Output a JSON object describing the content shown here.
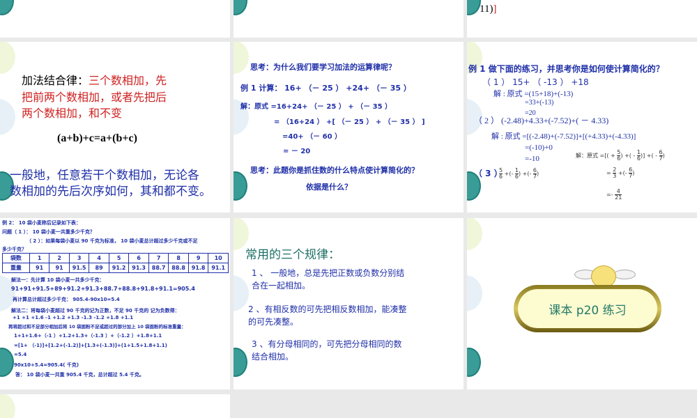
{
  "slides": [
    {
      "id": "s1"
    },
    {
      "id": "s2"
    },
    {
      "id": "s3",
      "fragment": "11)",
      "fragment_red": "]"
    },
    {
      "id": "s4",
      "title": "加法结合律：",
      "title_red": "三个数相加，先",
      "lines_red": [
        "把前两个数相加，或者先把后",
        "两个数相加，和不变"
      ],
      "formula": "(a+b)+c=a+(b+c)",
      "general": [
        "一般地，任意若干个数相加，无论各",
        "数相加的先后次序如何，其和都不变。"
      ]
    },
    {
      "id": "s5",
      "think1": "思考：为什么我们要学习加法的运算律呢？",
      "example": "例 1  计算： 16+ （－ 25 ） +24+ （－ 35 ）",
      "steps": [
        "解：原式 =16+24+ （－ 25 ） + （－ 35 ）",
        "= （16+24 ） +[ （－ 25 ） + （－ 35 ） ]",
        "=40+ （－ 60 ）",
        "= － 20"
      ],
      "think2": "思考：此题你是抓住数的什么特点使计算简化的？",
      "think3": "依据是什么？"
    },
    {
      "id": "s6",
      "title": "例 1 做下面的练习，并思考你是如何使计算简化的？",
      "p1": "（ 1 ）  15+ （ -13 ） +18",
      "p1_steps": [
        "解 : 原式 =(15+18)+(-13)",
        "=33+(-13)",
        "=20"
      ],
      "p2": "（ 2 ）  (-2.48)+4.33+(-7.52)+( － 4.33)",
      "p2_steps": [
        "解 : 原式 =[(-2.48)+(-7.52)]+[(+4.33)+(-4.33)]",
        "=(-10)+0",
        "=-10"
      ],
      "p3": "（ 3 ）",
      "p3_expr": {
        "a": [
          "5",
          "6"
        ],
        "b": [
          "1",
          "6"
        ],
        "c": [
          "6",
          "7"
        ]
      },
      "p3_sol_label": "解：原式 =[",
      "p3_sol2": [
        "2",
        "3"
      ],
      "p3_result": [
        "4",
        "21"
      ]
    },
    {
      "id": "s7",
      "lines": [
        "例 2：  10 袋小麦称后记录如下表：",
        "问题（ 1 ）： 10 袋小麦一共重多少千克？",
        "（ 2 ）：如果每袋小麦以 90 千克为标准， 10 袋小麦总计超过多少千克或不足",
        "多少千克？"
      ],
      "table": {
        "header": [
          "袋数",
          "1",
          "2",
          "3",
          "4",
          "5",
          "6",
          "7",
          "8",
          "9",
          "10"
        ],
        "row": [
          "重量",
          "91",
          "91",
          "91.5",
          "89",
          "91.2",
          "91.3",
          "88.7",
          "88.8",
          "91.8",
          "91.1"
        ]
      },
      "sol": [
        "解法一：先计算 10 袋小麦一共多少千克：",
        "91+91+91.5+89+91.2+91.3+88.7+88.8+91.8+91.1=905.4",
        "再计算总计超过多少千克：       905.4-90x10=5.4",
        "解法二：将每袋小麦超过 90 千克的记为正数，不足 90 千克的  记为负数得：",
        "+1    +1   +1.6   -1   +1.2   +1.3   -1.3   -1.2   +1.8   +1.1",
        "再将超过和不足部分相加后将 10 袋面粉不足或超过的部分加上 10 袋面粉的标准重量：",
        "1+1+1.6+（-1 ）+1.2+1.3+（-1.3 ）+（-1.2 ）+1.8+1.1",
        "=[1+ （-1)]+[1.2+(-1.2)]+[1.3+(-1.3)]+(1+1.5+1.8+1.1)",
        "=5.4",
        "90x10+5.4=905.4( 千克)",
        "答： 10 袋小麦一共重 905.4 千克，总计超过 5.4 千克。"
      ]
    },
    {
      "id": "s8",
      "title": "常用的三个规律：",
      "rules": [
        [
          "1 、  一般地，总是先把正数或负数分别结",
          "合在一起相加。"
        ],
        [
          "2 、有相反数的可先把相反数相加，能凑整",
          "的可先凑整。"
        ],
        [
          "3 、有分母相同的，可先把分母相同的数",
          "结合相加。"
        ]
      ]
    },
    {
      "id": "s9",
      "label": "课本 p20 练习"
    },
    {
      "id": "s10"
    }
  ],
  "colors": {
    "blue": "#1f2fa8",
    "red": "#d02020",
    "teal": "#227a6a",
    "background": "#e9e9e9"
  }
}
